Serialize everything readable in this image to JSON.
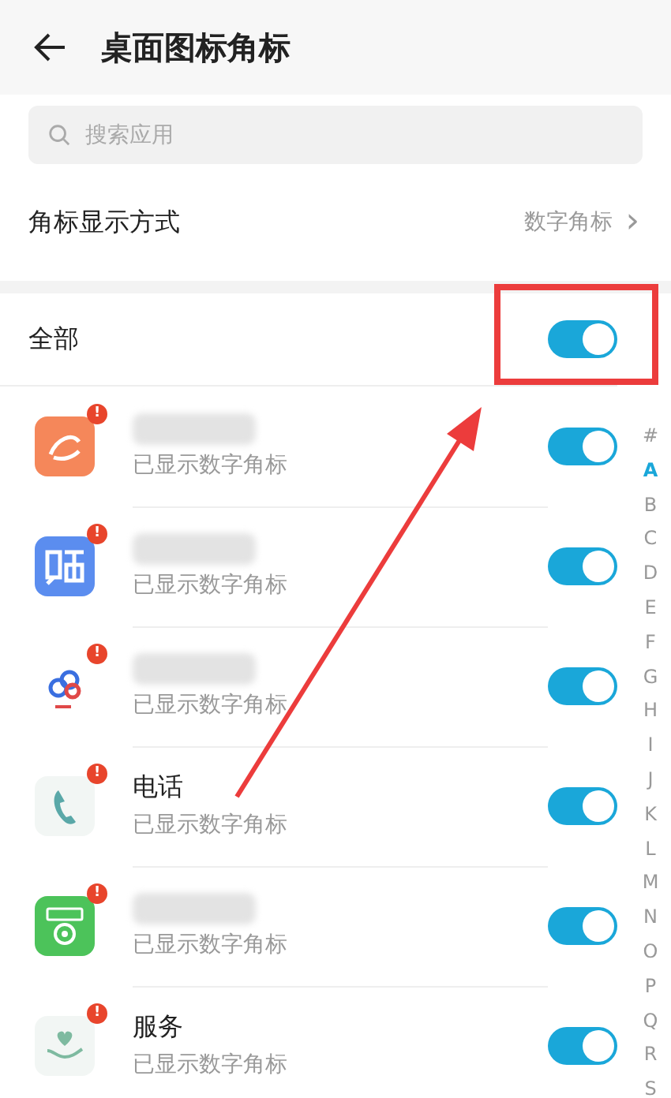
{
  "header": {
    "title": "桌面图标角标"
  },
  "search": {
    "placeholder": "搜索应用"
  },
  "badge_style": {
    "label": "角标显示方式",
    "value": "数字角标",
    "chevron": "›"
  },
  "all": {
    "label": "全部",
    "on": true
  },
  "apps": [
    {
      "name_blurred": true,
      "status": "已显示数字角标",
      "badge": "!",
      "on": true
    },
    {
      "name_blurred": true,
      "status": "已显示数字角标",
      "badge": "!",
      "on": true
    },
    {
      "name_blurred": true,
      "status": "已显示数字角标",
      "badge": "!",
      "on": true
    },
    {
      "name": "电话",
      "name_blurred": false,
      "status": "已显示数字角标",
      "badge": "!",
      "on": true
    },
    {
      "name_blurred": true,
      "status": "已显示数字角标",
      "badge": "!",
      "on": true
    },
    {
      "name": "服务",
      "name_blurred": false,
      "status": "已显示数字角标",
      "badge": "!",
      "on": true
    }
  ],
  "index": [
    {
      "label": "#",
      "selected": false
    },
    {
      "label": "A",
      "selected": true
    },
    {
      "label": "B",
      "selected": false
    },
    {
      "label": "C",
      "selected": false
    },
    {
      "label": "D",
      "selected": false
    },
    {
      "label": "E",
      "selected": false
    },
    {
      "label": "F",
      "selected": false
    },
    {
      "label": "G",
      "selected": false
    },
    {
      "label": "H",
      "selected": false
    },
    {
      "label": "I",
      "selected": false
    },
    {
      "label": "J",
      "selected": false
    },
    {
      "label": "K",
      "selected": false
    },
    {
      "label": "L",
      "selected": false
    },
    {
      "label": "M",
      "selected": false
    },
    {
      "label": "N",
      "selected": false
    },
    {
      "label": "O",
      "selected": false
    },
    {
      "label": "P",
      "selected": false
    },
    {
      "label": "Q",
      "selected": false
    },
    {
      "label": "R",
      "selected": false
    },
    {
      "label": "S",
      "selected": false
    }
  ],
  "annotation": {
    "highlight_box": true,
    "arrow": true
  }
}
